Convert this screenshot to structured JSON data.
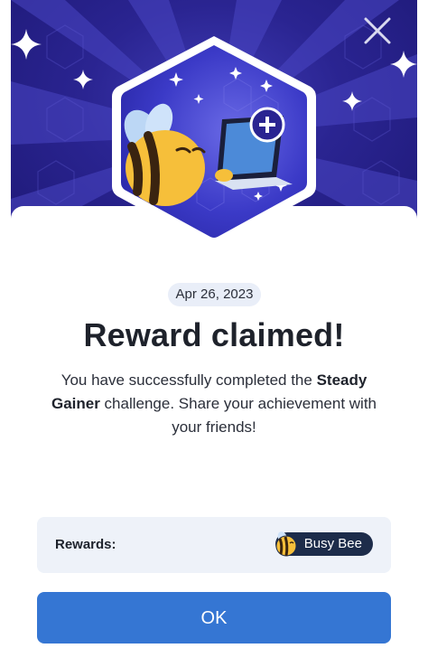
{
  "hero": {
    "badge_icon": "busy-bee-laptop-hexagon",
    "close_icon": "close-icon",
    "colors": {
      "background": "#2a2491",
      "badge_border": "#ffffff",
      "badge_fill": "#3b3ac7"
    }
  },
  "date": "Apr 26, 2023",
  "title": "Reward claimed!",
  "description": {
    "before": "You have successfully completed the ",
    "challenge": "Steady Gainer",
    "after": " challenge. Share your achievement with your friends!"
  },
  "rewards": {
    "label": "Rewards:",
    "item": {
      "name": "Busy Bee",
      "icon": "bee-icon"
    }
  },
  "ok_button": {
    "label": "OK",
    "color": "#3576d3"
  }
}
